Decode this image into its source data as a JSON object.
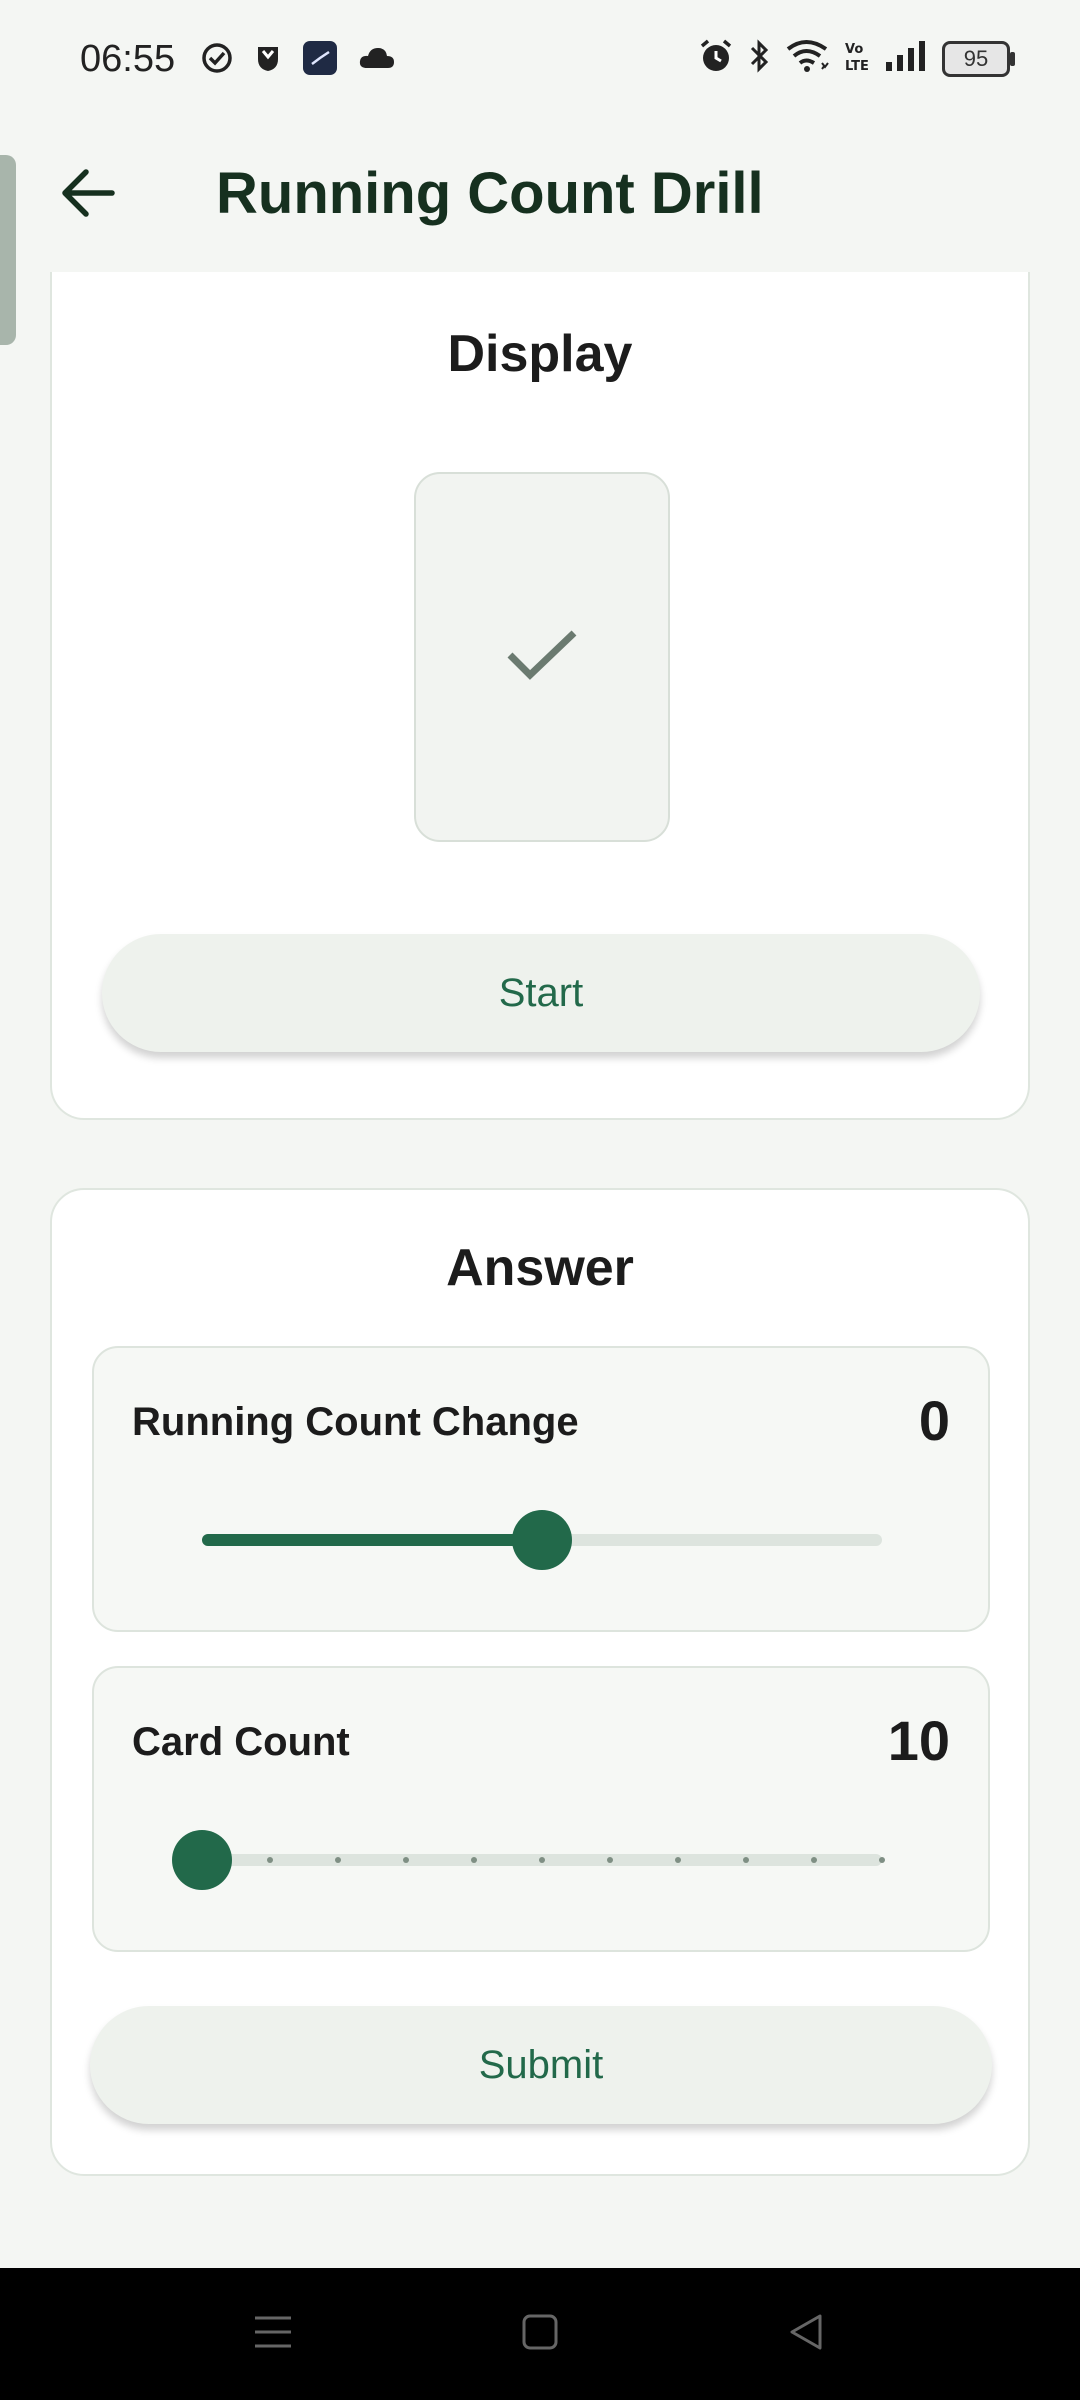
{
  "status_bar": {
    "time": "06:55",
    "battery": "95",
    "left_icons": [
      "task-check-icon",
      "shield-icon",
      "clock-app-icon",
      "cloud-icon"
    ],
    "right_icons": [
      "alarm-icon",
      "bluetooth-icon",
      "wifi-icon",
      "volte-icon",
      "signal-icon",
      "battery-icon"
    ]
  },
  "header": {
    "title": "Running Count Drill",
    "back_icon": "arrow-left-icon"
  },
  "display_section": {
    "title": "Display",
    "card_icon": "checkmark-icon",
    "start_label": "Start"
  },
  "answer_section": {
    "title": "Answer",
    "running_count": {
      "label": "Running Count Change",
      "value": "0",
      "position": 0.5
    },
    "card_count": {
      "label": "Card Count",
      "value": "10",
      "position": 0.0,
      "steps": 10
    },
    "submit_label": "Submit"
  },
  "colors": {
    "accent": "#22694a",
    "background": "#f4f6f3",
    "card": "#ffffff",
    "title": "#16301f"
  },
  "nav_bar": {
    "icons": [
      "menu-icon",
      "home-square-icon",
      "back-triangle-icon"
    ]
  }
}
